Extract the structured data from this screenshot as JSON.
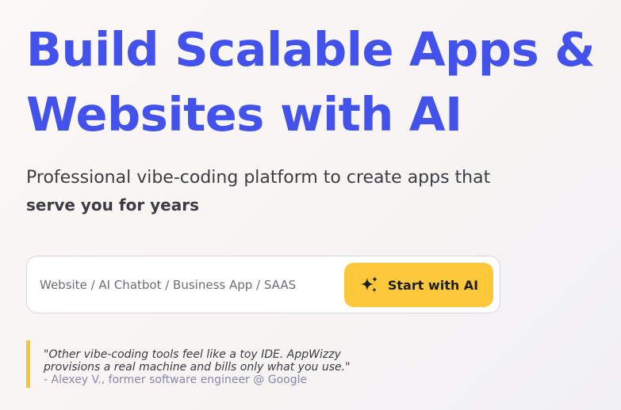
{
  "hero": {
    "title_line1": "Build Scalable Apps &",
    "title_line2": "Websites with AI",
    "subtitle_line1": "Professional vibe-coding platform to create apps that",
    "subtitle_line2": "serve you for years"
  },
  "prompt": {
    "placeholder": "Website / AI Chatbot / Business App / SAAS",
    "value": "",
    "button_label": "Start with AI",
    "button_icon": "sparkles-icon"
  },
  "testimonial": {
    "quote_line1": "\"Other vibe-coding tools feel like a toy IDE. AppWizzy",
    "quote_line2": "provisions a real machine and bills only what you use.\"",
    "attribution": "- Alexey V., former software engineer @ Google"
  },
  "colors": {
    "title": "#4352ea",
    "button": "#fdc93a",
    "quote_bar": "#f6c533",
    "attribution": "#8888a8"
  }
}
